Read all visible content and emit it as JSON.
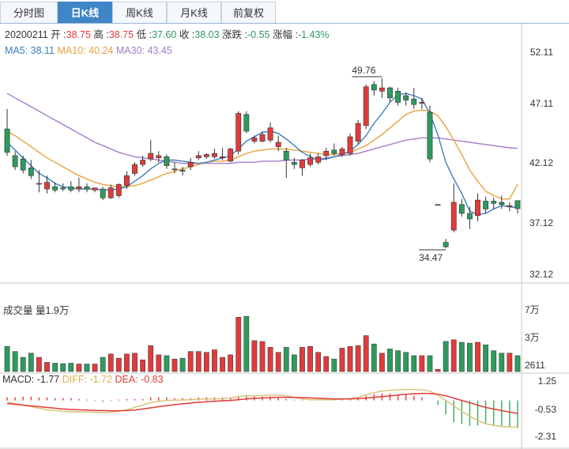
{
  "tabs": [
    "分时图",
    "日K线",
    "周K线",
    "月K线",
    "前复权"
  ],
  "active_tab": 1,
  "info": {
    "date": "20200211",
    "open_label": "开 :",
    "open": "38.75",
    "high_label": "高 :",
    "high": "38.75",
    "low_label": "低 :",
    "low": "37.60",
    "close_label": "收 :",
    "close": "38.03",
    "change_label": "涨跌 :",
    "change": "-0.55",
    "pct_label": "涨幅 :",
    "pct": "-1.43%"
  },
  "ma": {
    "ma5_label": "MA5: 38.11",
    "ma10_label": "MA10: 40.24",
    "ma30_label": "MA30: 43.45"
  },
  "volume_label": "成交量 量1.9万",
  "macd": {
    "macd_label": "MACD: -1.77",
    "diff_label": "DIFF: -1.72",
    "dea_label": "DEA: -0.83"
  },
  "colors": {
    "up": "#e03b3b",
    "down": "#2e9a5e",
    "ma5": "#3b7fbf",
    "ma10": "#e8a23c",
    "ma30": "#a67cc6",
    "diff": "#d9c47a",
    "dea": "#e03b3b"
  },
  "chart_data": [
    {
      "type": "candlestick",
      "price_axis_ticks": [
        "52.11",
        "47.11",
        "42.12",
        "37.12",
        "32.12"
      ],
      "ylim": [
        32.12,
        52.11
      ],
      "annotations": [
        {
          "text": "49.76",
          "value": 49.76,
          "kind": "high"
        },
        {
          "text": "34.47",
          "value": 34.47,
          "kind": "low"
        }
      ],
      "candles": [
        [
          45.2,
          47.0,
          43.1,
          42.8
        ],
        [
          42.8,
          43.2,
          41.8,
          41.5
        ],
        [
          42.5,
          42.8,
          41.5,
          41.2
        ],
        [
          41.7,
          42.4,
          41.0,
          40.7
        ],
        [
          40.3,
          41.5,
          40.3,
          39.5
        ],
        [
          39.8,
          41.0,
          40.4,
          39.4
        ],
        [
          40.0,
          40.4,
          39.7,
          39.5
        ],
        [
          39.9,
          40.3,
          39.8,
          39.6
        ],
        [
          40.0,
          40.5,
          39.7,
          39.5
        ],
        [
          39.8,
          40.8,
          40.0,
          39.5
        ],
        [
          40.0,
          40.3,
          39.8,
          39.5
        ],
        [
          39.7,
          39.9,
          39.9,
          39.5
        ],
        [
          39.8,
          40.0,
          39.0,
          38.8
        ],
        [
          39.0,
          40.2,
          39.9,
          38.9
        ],
        [
          39.2,
          40.3,
          40.2,
          39.0
        ],
        [
          40.1,
          41.4,
          41.0,
          39.8
        ],
        [
          41.2,
          42.2,
          42.0,
          41.0
        ],
        [
          42.0,
          42.8,
          42.4,
          41.8
        ],
        [
          42.5,
          44.2,
          43.0,
          42.3
        ],
        [
          42.6,
          43.2,
          42.8,
          42.2
        ],
        [
          42.7,
          42.9,
          41.9,
          41.6
        ],
        [
          41.6,
          42.2,
          41.6,
          41.2
        ],
        [
          41.5,
          41.8,
          41.4,
          41.0
        ],
        [
          41.8,
          42.6,
          42.2,
          41.5
        ],
        [
          42.6,
          43.2,
          42.8,
          42.4
        ],
        [
          42.7,
          43.0,
          42.9,
          42.5
        ],
        [
          42.7,
          43.4,
          43.0,
          42.5
        ],
        [
          42.6,
          43.5,
          42.7,
          42.4
        ],
        [
          42.3,
          43.5,
          43.4,
          42.2
        ],
        [
          43.2,
          46.8,
          46.6,
          42.9
        ],
        [
          46.5,
          46.8,
          45.0,
          44.8
        ],
        [
          44.1,
          44.6,
          44.4,
          43.9
        ],
        [
          44.1,
          45.0,
          44.7,
          44.0
        ],
        [
          44.2,
          45.8,
          45.3,
          44.0
        ],
        [
          43.6,
          44.6,
          44.0,
          43.2
        ],
        [
          43.2,
          43.5,
          42.4,
          40.8
        ],
        [
          42.2,
          42.6,
          42.0,
          41.6
        ],
        [
          41.7,
          42.5,
          42.4,
          41.0
        ],
        [
          42.0,
          43.0,
          42.6,
          41.8
        ],
        [
          42.2,
          43.0,
          42.7,
          42.0
        ],
        [
          42.8,
          43.5,
          43.2,
          42.4
        ],
        [
          43.3,
          43.9,
          43.0,
          42.8
        ],
        [
          42.9,
          43.6,
          43.4,
          42.7
        ],
        [
          43.0,
          44.8,
          44.5,
          42.8
        ],
        [
          44.1,
          46.0,
          45.7,
          43.8
        ],
        [
          45.5,
          49.2,
          49.0,
          45.2
        ],
        [
          49.2,
          49.5,
          48.7,
          48.2
        ],
        [
          48.6,
          49.76,
          48.9,
          48.0
        ],
        [
          48.9,
          49.0,
          48.0,
          47.6
        ],
        [
          48.6,
          48.9,
          47.6,
          47.3
        ],
        [
          48.2,
          48.5,
          47.8,
          47.3
        ],
        [
          47.9,
          48.9,
          47.4,
          47.0
        ],
        [
          47.5,
          48.0,
          47.6,
          47.0
        ],
        [
          46.7,
          47.3,
          42.5,
          42.2
        ],
        [
          38.4,
          38.4,
          38.4,
          38.4
        ],
        [
          35.0,
          35.3,
          34.6,
          34.47
        ],
        [
          36.1,
          40.3,
          38.6,
          35.9
        ],
        [
          38.4,
          38.9,
          37.6,
          37.3
        ],
        [
          37.6,
          38.2,
          37.1,
          36.2
        ],
        [
          37.4,
          39.4,
          38.8,
          36.9
        ],
        [
          38.7,
          39.1,
          38.0,
          37.6
        ],
        [
          38.7,
          39.0,
          38.5,
          38.0
        ],
        [
          38.6,
          39.2,
          38.4,
          38.0
        ],
        [
          38.2,
          38.6,
          38.3,
          37.8
        ],
        [
          38.75,
          38.75,
          38.03,
          37.6
        ]
      ],
      "ma5": [
        44.0,
        43.3,
        42.6,
        41.9,
        41.2,
        40.8,
        40.3,
        40.0,
        39.9,
        39.8,
        39.8,
        39.8,
        39.7,
        39.7,
        39.8,
        40.0,
        40.5,
        41.0,
        41.6,
        42.1,
        42.4,
        42.4,
        42.3,
        42.2,
        42.1,
        42.2,
        42.4,
        42.6,
        42.8,
        43.4,
        44.1,
        44.5,
        44.9,
        45.0,
        44.8,
        44.3,
        43.7,
        43.1,
        42.7,
        42.4,
        42.5,
        42.7,
        42.9,
        43.2,
        43.8,
        44.6,
        45.7,
        46.6,
        47.6,
        48.3,
        48.4,
        48.2,
        47.9,
        46.6,
        44.7,
        42.2,
        40.7,
        39.4,
        37.8,
        37.5,
        37.6,
        38.0,
        38.3,
        38.2,
        38.11
      ],
      "ma10": [
        45.0,
        44.6,
        44.1,
        43.6,
        43.1,
        42.6,
        42.2,
        41.8,
        41.4,
        41.0,
        40.7,
        40.4,
        40.2,
        40.1,
        40.0,
        40.0,
        40.1,
        40.3,
        40.6,
        40.9,
        41.2,
        41.4,
        41.6,
        41.8,
        42.0,
        42.2,
        42.3,
        42.3,
        42.4,
        42.7,
        43.0,
        43.2,
        43.3,
        43.4,
        43.4,
        43.4,
        43.3,
        43.2,
        43.1,
        43.0,
        42.9,
        42.9,
        43.0,
        43.1,
        43.4,
        43.7,
        44.2,
        44.7,
        45.3,
        45.9,
        46.5,
        46.8,
        46.9,
        46.8,
        46.4,
        45.4,
        44.2,
        42.9,
        41.5,
        40.5,
        39.6,
        39.2,
        38.9,
        38.9,
        40.24
      ],
      "ma30": [
        48.4,
        48.0,
        47.6,
        47.2,
        46.8,
        46.4,
        46.0,
        45.6,
        45.2,
        44.8,
        44.4,
        44.0,
        43.7,
        43.4,
        43.1,
        42.9,
        42.7,
        42.6,
        42.5,
        42.4,
        42.3,
        42.2,
        42.1,
        42.1,
        42.1,
        42.1,
        42.1,
        42.1,
        42.1,
        42.2,
        42.2,
        42.2,
        42.3,
        42.3,
        42.3,
        42.4,
        42.4,
        42.4,
        42.5,
        42.5,
        42.6,
        42.7,
        42.8,
        42.9,
        43.0,
        43.2,
        43.4,
        43.6,
        43.8,
        44.0,
        44.2,
        44.3,
        44.4,
        44.4,
        44.4,
        44.3,
        44.2,
        44.1,
        44.0,
        43.9,
        43.8,
        43.7,
        43.6,
        43.5,
        43.45
      ]
    },
    {
      "type": "bar",
      "name": "volume",
      "axis_ticks": [
        "7万",
        "3万",
        "2611"
      ],
      "ylim": [
        0,
        70000
      ],
      "values": [
        30000,
        24000,
        17000,
        22000,
        17000,
        11000,
        10000,
        9500,
        10000,
        9000,
        9000,
        9000,
        17000,
        21000,
        16000,
        21000,
        22000,
        14000,
        31000,
        20000,
        19000,
        15000,
        16000,
        24000,
        24000,
        23000,
        26000,
        17000,
        20000,
        65000,
        66000,
        37000,
        36000,
        29000,
        23000,
        29000,
        20000,
        29000,
        30000,
        23000,
        18000,
        15000,
        28000,
        30000,
        31000,
        43000,
        33000,
        22000,
        27000,
        25000,
        23000,
        19000,
        19000,
        19000,
        2611,
        36000,
        38000,
        35000,
        34000,
        35000,
        32000,
        25000,
        22000,
        22000,
        19000
      ]
    },
    {
      "type": "bar",
      "name": "MACD",
      "axis_ticks": [
        "1.25",
        "-0.53",
        "-2.31"
      ],
      "ylim": [
        -2.31,
        1.25
      ],
      "values": [
        0.2,
        0.2,
        0.25,
        0.25,
        0.2,
        0.2,
        0.15,
        0.15,
        0.15,
        0.1,
        0.05,
        -0.05,
        -0.1,
        -0.05,
        0.05,
        0.1,
        0.1,
        0.1,
        0.2,
        0.2,
        0.2,
        0.15,
        0.15,
        0.15,
        0.2,
        0.2,
        0.2,
        0.2,
        0.2,
        0.3,
        0.35,
        0.3,
        0.25,
        0.25,
        0.2,
        0.1,
        0.05,
        0.05,
        0.05,
        0.05,
        0.05,
        0.05,
        0.1,
        0.1,
        0.2,
        0.3,
        0.4,
        0.45,
        0.45,
        0.4,
        0.35,
        0.3,
        0.2,
        0.0,
        -0.3,
        -0.9,
        -1.4,
        -1.5,
        -1.65,
        -1.6,
        -1.5,
        -1.6,
        -1.65,
        -1.7,
        -1.77
      ],
      "diff": [
        -0.1,
        -0.2,
        -0.3,
        -0.4,
        -0.5,
        -0.6,
        -0.65,
        -0.7,
        -0.72,
        -0.74,
        -0.75,
        -0.76,
        -0.78,
        -0.76,
        -0.7,
        -0.6,
        -0.45,
        -0.3,
        -0.15,
        -0.05,
        0.0,
        0.02,
        0.03,
        0.05,
        0.08,
        0.1,
        0.1,
        0.12,
        0.15,
        0.25,
        0.3,
        0.3,
        0.32,
        0.35,
        0.35,
        0.3,
        0.2,
        0.1,
        0.05,
        0.05,
        0.05,
        0.05,
        0.08,
        0.12,
        0.2,
        0.35,
        0.5,
        0.6,
        0.65,
        0.68,
        0.7,
        0.7,
        0.68,
        0.6,
        0.35,
        0.0,
        -0.35,
        -0.7,
        -1.0,
        -1.3,
        -1.5,
        -1.6,
        -1.68,
        -1.7,
        -1.72
      ],
      "dea": [
        -0.2,
        -0.25,
        -0.3,
        -0.35,
        -0.4,
        -0.45,
        -0.5,
        -0.55,
        -0.58,
        -0.6,
        -0.62,
        -0.64,
        -0.65,
        -0.66,
        -0.66,
        -0.65,
        -0.62,
        -0.55,
        -0.48,
        -0.4,
        -0.33,
        -0.27,
        -0.22,
        -0.17,
        -0.12,
        -0.08,
        -0.05,
        -0.02,
        0.0,
        0.05,
        0.1,
        0.13,
        0.16,
        0.18,
        0.2,
        0.2,
        0.2,
        0.18,
        0.16,
        0.14,
        0.12,
        0.1,
        0.1,
        0.1,
        0.12,
        0.15,
        0.2,
        0.25,
        0.3,
        0.35,
        0.4,
        0.43,
        0.45,
        0.45,
        0.4,
        0.3,
        0.15,
        0.0,
        -0.15,
        -0.3,
        -0.45,
        -0.55,
        -0.65,
        -0.75,
        -0.83
      ]
    }
  ]
}
